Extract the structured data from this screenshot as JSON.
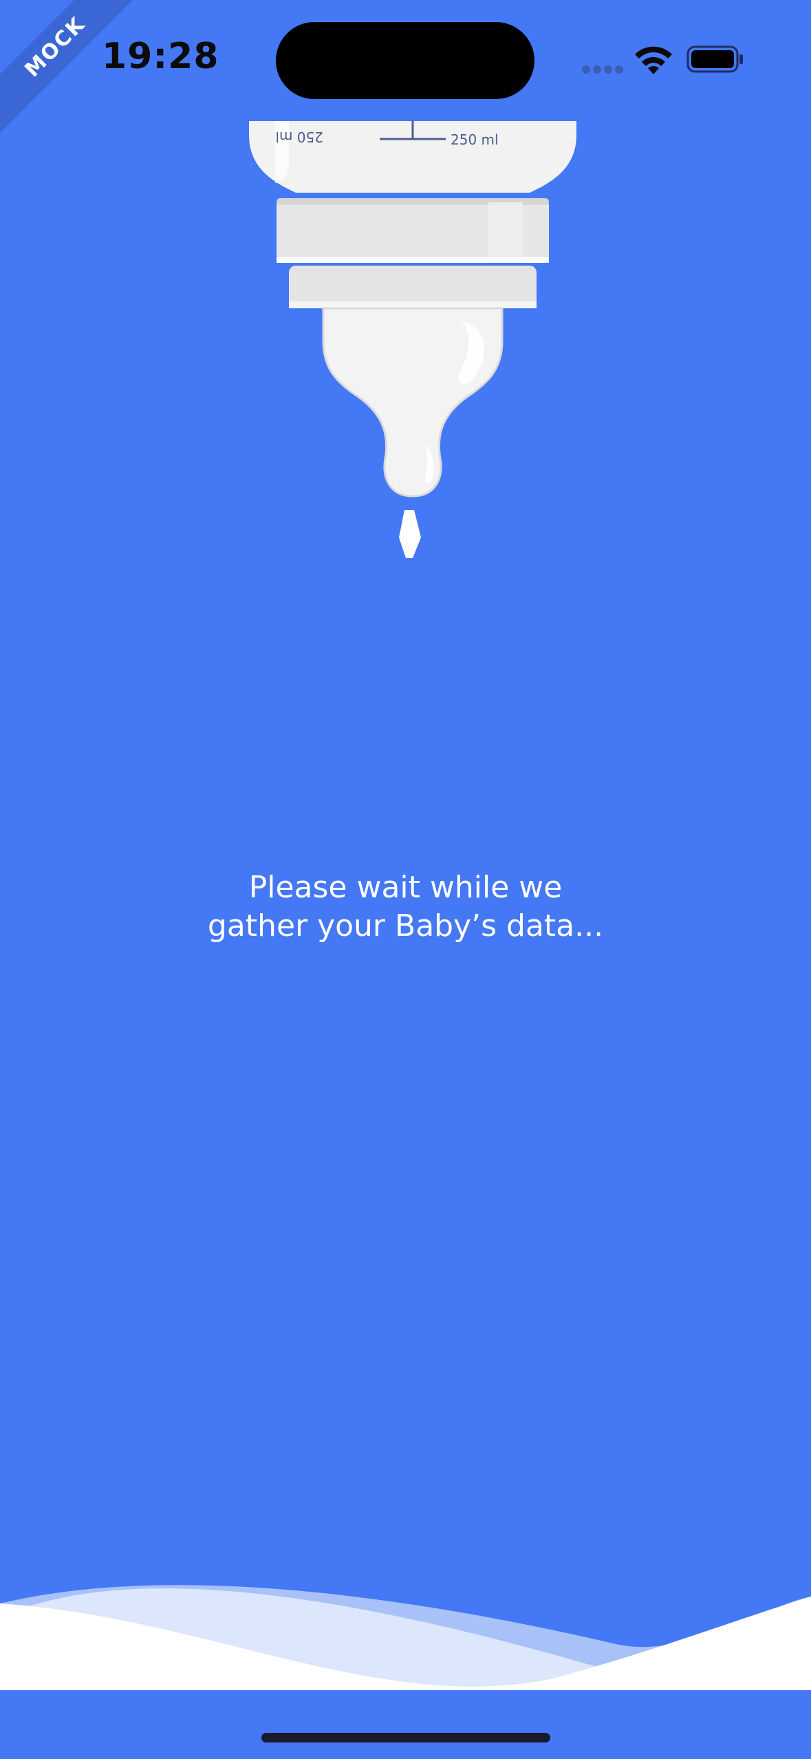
{
  "status_bar": {
    "time": "19:28",
    "wifi_icon": "wifi-icon",
    "battery_icon": "battery-icon",
    "signal_icon": "signal-dots-icon"
  },
  "ribbon": {
    "label": "MOCK"
  },
  "bottle": {
    "measure_left": "250 ml",
    "measure_right": "250 ml"
  },
  "loading": {
    "line1": "Please wait while we",
    "line2": "gather your Baby’s data..."
  },
  "colors": {
    "background": "#4478F5",
    "wave_white": "#FFFFFF",
    "wave_light": "#DCE6FC",
    "wave_mid": "#A9C1F9"
  }
}
